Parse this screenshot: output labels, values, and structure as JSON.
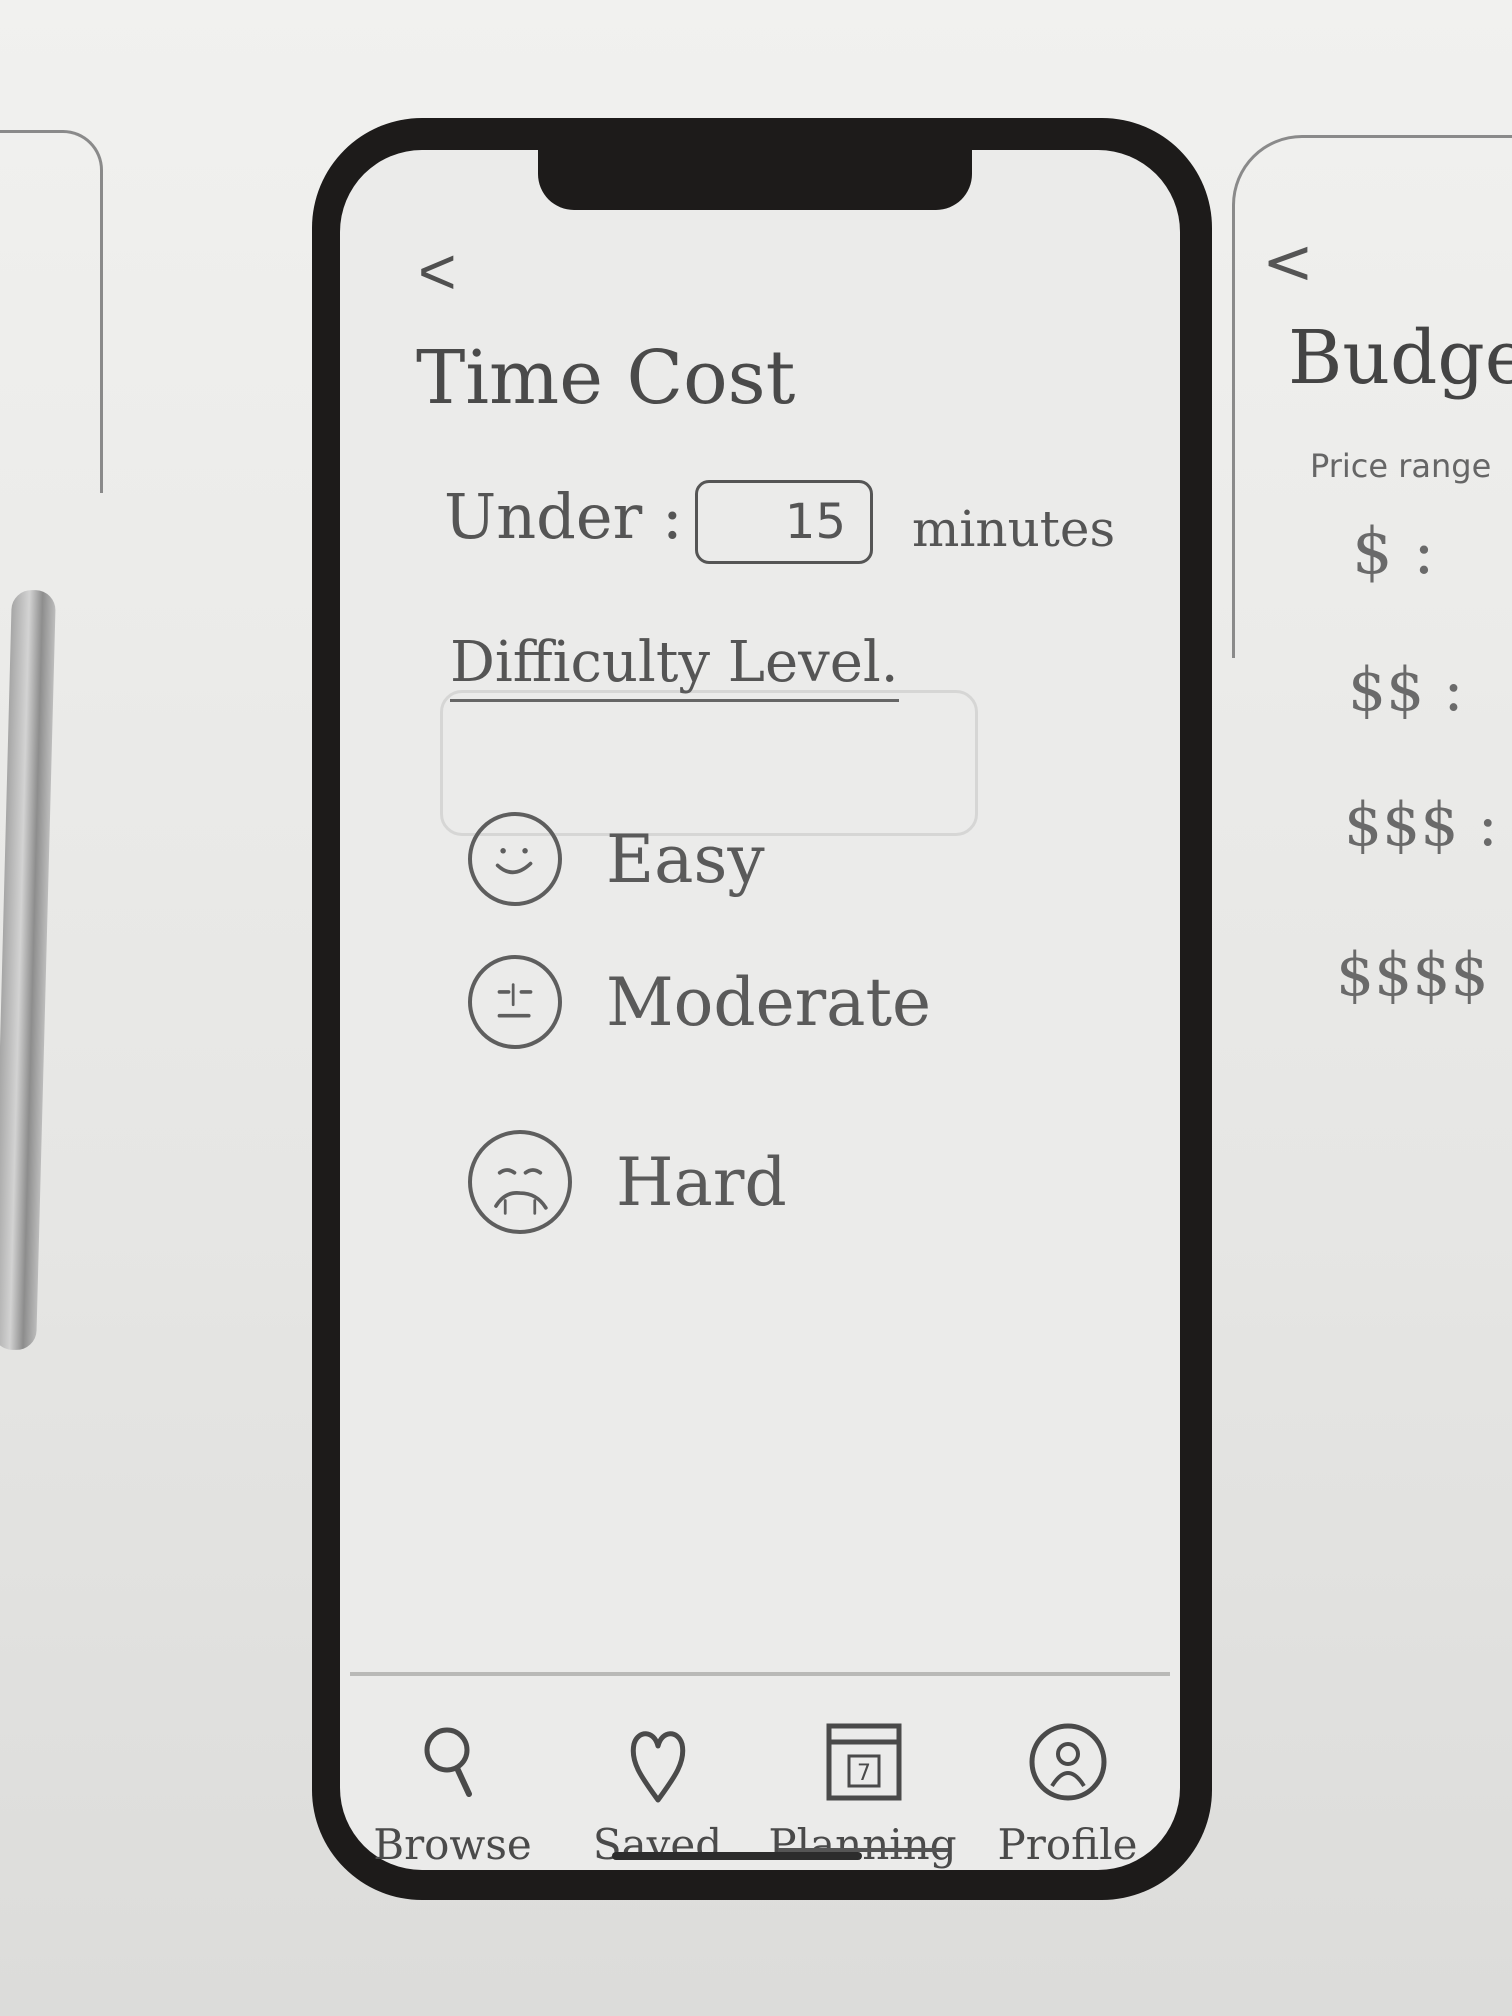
{
  "screen": {
    "back_glyph": "<",
    "title": "Time Cost",
    "time_filter": {
      "label": "Under :",
      "value": "15",
      "unit": "minutes"
    },
    "difficulty": {
      "label": "Difficulty Level.",
      "options": [
        {
          "label": "Easy",
          "icon": "happy-face-icon"
        },
        {
          "label": "Moderate",
          "icon": "neutral-face-icon"
        },
        {
          "label": "Hard",
          "icon": "sad-face-icon"
        }
      ]
    }
  },
  "tabbar": {
    "tabs": [
      {
        "label": "Browse",
        "icon": "search-icon"
      },
      {
        "label": "Saved",
        "icon": "heart-icon"
      },
      {
        "label": "Planning",
        "icon": "calendar-icon",
        "badge": "7"
      },
      {
        "label": "Profile",
        "icon": "profile-icon"
      }
    ]
  },
  "adjacent_screen": {
    "back_glyph": "<",
    "title": "Budget",
    "subtitle": "Price range",
    "price_levels": [
      "$ :",
      "$$ :",
      "$$$ :",
      "$$$$ :"
    ]
  }
}
